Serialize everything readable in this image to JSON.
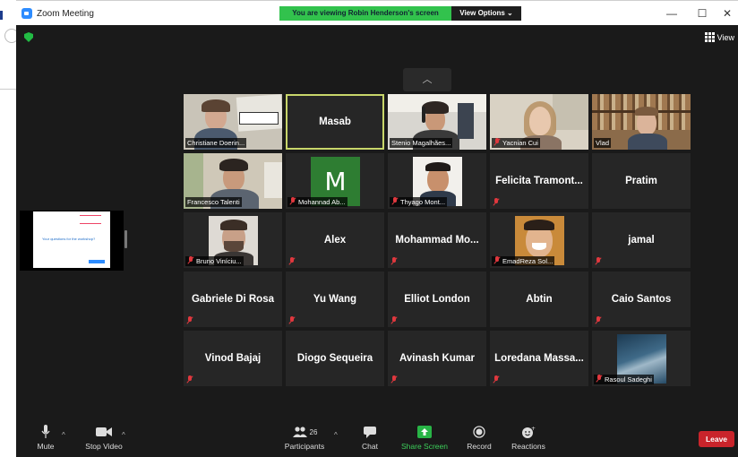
{
  "window": {
    "title": "Zoom Meeting",
    "controls": [
      "—",
      "☐",
      "✕"
    ]
  },
  "banner": {
    "viewing_text": "You are viewing Robin Henderson's screen",
    "view_options_label": "View Options ⌄"
  },
  "header": {
    "view_label": "View"
  },
  "shared_screen": {
    "question_text": "Your questions for the workshop?"
  },
  "participants": [
    {
      "name": "Christiane Doerin...",
      "video": true,
      "muted": false
    },
    {
      "name": "Masab",
      "video": false,
      "muted": false,
      "speaker": true
    },
    {
      "name": "Stenio Magalhães...",
      "video": true,
      "muted": false
    },
    {
      "name": "Yacnian Cui",
      "video": true,
      "muted": true
    },
    {
      "name": "Vlad",
      "video": true,
      "muted": false
    },
    {
      "name": "Francesco Talenti",
      "video": true,
      "muted": false
    },
    {
      "name": "Mohannad Ab...",
      "video": false,
      "muted": true,
      "avatar_letter": "M"
    },
    {
      "name": "Thyago Mont...",
      "video": false,
      "muted": true,
      "avatar_photo": true
    },
    {
      "name": "Felicita  Tramont...",
      "video": false,
      "muted": true
    },
    {
      "name": "Pratim",
      "video": false,
      "muted": false
    },
    {
      "name": "Bruno Viníciu...",
      "video": true,
      "muted": true
    },
    {
      "name": "Alex",
      "video": false,
      "muted": true
    },
    {
      "name": "Mohammad  Mo...",
      "video": false,
      "muted": true
    },
    {
      "name": "EmadReza Sol...",
      "video": false,
      "muted": true,
      "avatar_photo": true
    },
    {
      "name": "jamal",
      "video": false,
      "muted": true
    },
    {
      "name": "Gabriele Di Rosa",
      "video": false,
      "muted": true
    },
    {
      "name": "Yu Wang",
      "video": false,
      "muted": true
    },
    {
      "name": "Elliot London",
      "video": false,
      "muted": true
    },
    {
      "name": "Abtin",
      "video": false,
      "muted": false
    },
    {
      "name": "Caio Santos",
      "video": false,
      "muted": true
    },
    {
      "name": "Vinod Bajaj",
      "video": false,
      "muted": true
    },
    {
      "name": "Diogo Sequeira",
      "video": false,
      "muted": false
    },
    {
      "name": "Avinash Kumar",
      "video": false,
      "muted": true
    },
    {
      "name": "Loredana  Massa...",
      "video": false,
      "muted": true
    },
    {
      "name": "Rasoul Sadeghi",
      "video": false,
      "muted": true,
      "avatar_photo": true
    }
  ],
  "toolbar": {
    "mute_label": "Mute",
    "stop_video_label": "Stop Video",
    "participants_label": "Participants",
    "participants_count": "26",
    "chat_label": "Chat",
    "share_screen_label": "Share Screen",
    "record_label": "Record",
    "reactions_label": "Reactions",
    "leave_label": "Leave"
  },
  "colors": {
    "banner_green": "#32c24d",
    "leave_red": "#c9242b",
    "speaker_border": "#c8d66a",
    "mute_red": "#e0383e",
    "avatar_green": "#2e7d32"
  }
}
